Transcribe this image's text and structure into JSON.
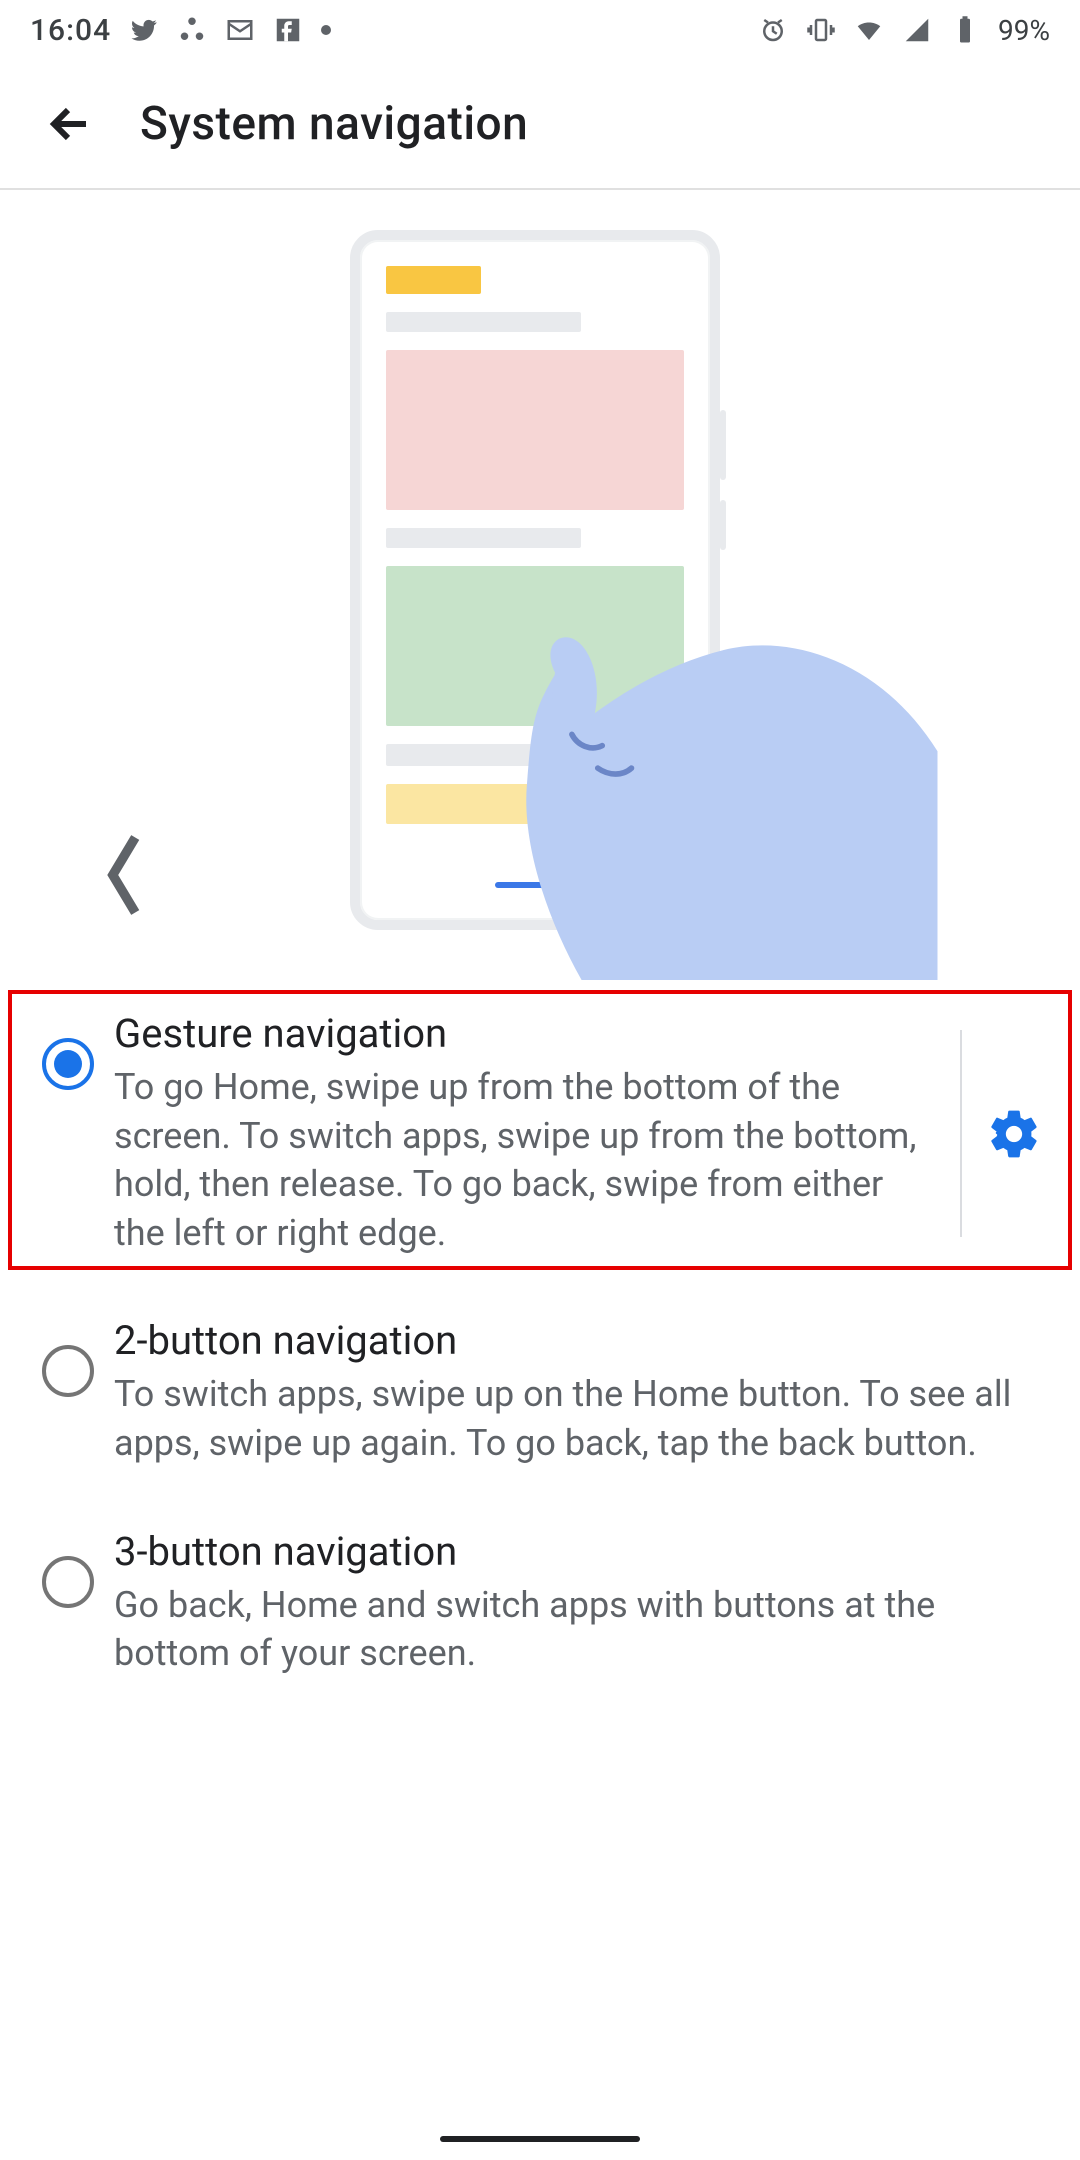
{
  "status_bar": {
    "time": "16:04",
    "battery_percent": "99%"
  },
  "header": {
    "title": "System navigation"
  },
  "options": [
    {
      "id": "gesture",
      "title": "Gesture navigation",
      "description": "To go Home, swipe up from the bottom of the screen. To switch apps, swipe up from the bottom, hold, then release. To go back, swipe from either the left or right edge.",
      "selected": true,
      "has_settings": true,
      "highlighted": true
    },
    {
      "id": "two_button",
      "title": "2-button navigation",
      "description": "To switch apps, swipe up on the Home button. To see all apps, swipe up again. To go back, tap the back button.",
      "selected": false,
      "has_settings": false,
      "highlighted": false
    },
    {
      "id": "three_button",
      "title": "3-button navigation",
      "description": "Go back, Home and switch apps with buttons at the bottom of your screen.",
      "selected": false,
      "has_settings": false,
      "highlighted": false
    }
  ],
  "colors": {
    "accent": "#1a73e8",
    "highlight_border": "#e60000"
  }
}
